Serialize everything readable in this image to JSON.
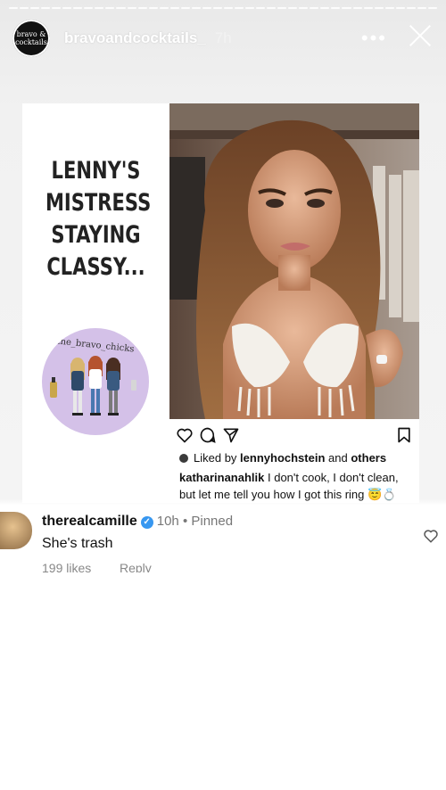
{
  "story": {
    "username": "bravoandcocktails_",
    "time": "7h",
    "more_label": "•••",
    "avatar_text": "bravo & cocktails"
  },
  "post": {
    "headline": [
      "LENNY'S",
      "MISTRESS",
      "STAYING",
      "CLASSY..."
    ],
    "badge_text": "the_bravo_chicks",
    "liked_prefix": "Liked by",
    "liked_user": "lennyhochstein",
    "liked_mid": "and",
    "liked_others": "others",
    "caption_user": "katharinanahlik",
    "caption_text": "I don't cook, I don't clean, but let me tell you how I got this ring 😇💍",
    "icons": [
      "heart-icon",
      "comment-icon",
      "share-icon",
      "bookmark-icon"
    ]
  },
  "comment": {
    "username": "therealcamille",
    "verified_glyph": "✓",
    "time": "10h",
    "pinned": "Pinned",
    "separator": "•",
    "text": "She's trash",
    "likes": "199 likes",
    "reply": "Reply"
  },
  "colors": {
    "badge_bg": "#d4c1e8",
    "verified": "#3797f0"
  }
}
